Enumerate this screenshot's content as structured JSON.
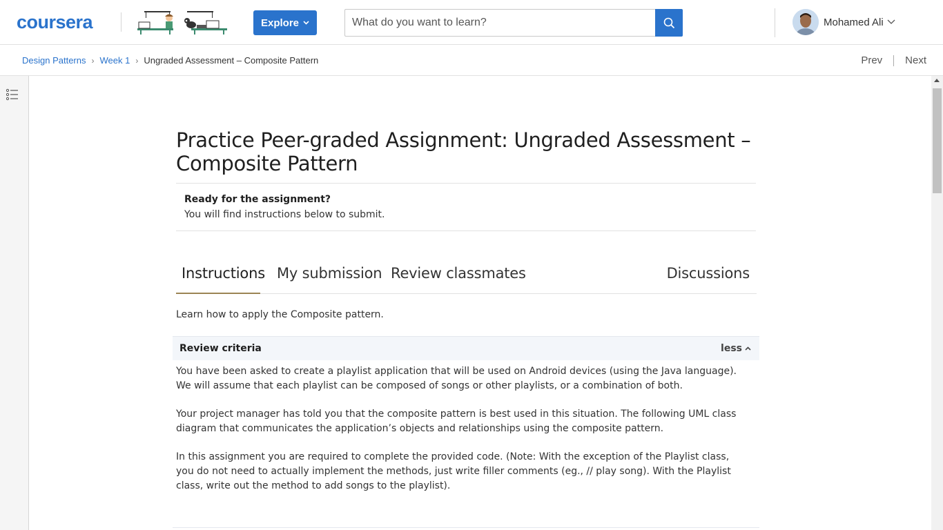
{
  "header": {
    "logo_text": "coursera",
    "explore_label": "Explore",
    "search_placeholder": "What do you want to learn?",
    "user_name": "Mohamed Ali"
  },
  "breadcrumb": {
    "items": [
      "Design Patterns",
      "Week 1"
    ],
    "current": "Ungraded Assessment – Composite Pattern",
    "prev_label": "Prev",
    "next_label": "Next"
  },
  "main": {
    "title": "Practice Peer-graded Assignment: Ungraded Assessment – Composite Pattern",
    "ready_title": "Ready for the assignment?",
    "ready_text": "You will find instructions below to submit.",
    "tabs": [
      {
        "label": "Instructions",
        "active": true
      },
      {
        "label": "My submission",
        "active": false
      },
      {
        "label": "Review classmates",
        "active": false
      },
      {
        "label": "Discussions",
        "active": false
      }
    ],
    "intro": "Learn how to apply the Composite pattern.",
    "criteria_title": "Review criteria",
    "criteria_toggle": "less",
    "paragraphs": [
      "You have been asked to create a playlist application that will be used on Android devices (using the Java language). We will assume that each playlist can be composed of songs or other playlists, or a combination of both.",
      "Your project manager has told you that the composite pattern is best used in this situation. The following UML class diagram that communicates the application’s objects and relationships using the composite pattern.",
      "In this assignment you are required to complete the provided code. (Note: With the exception of the Playlist class, you do not need to actually implement the methods, just write filler comments (eg., // play song). With the Playlist class, write out the method to add songs to the playlist)."
    ]
  },
  "colors": {
    "brand": "#2a73cc",
    "tab_underline": "#9b8453",
    "criteria_bg": "#f3f6fa"
  },
  "icons": [
    "search-icon",
    "chevron-down-icon",
    "chevron-up-icon",
    "table-of-contents-icon",
    "breadcrumb-chevron-icon"
  ]
}
